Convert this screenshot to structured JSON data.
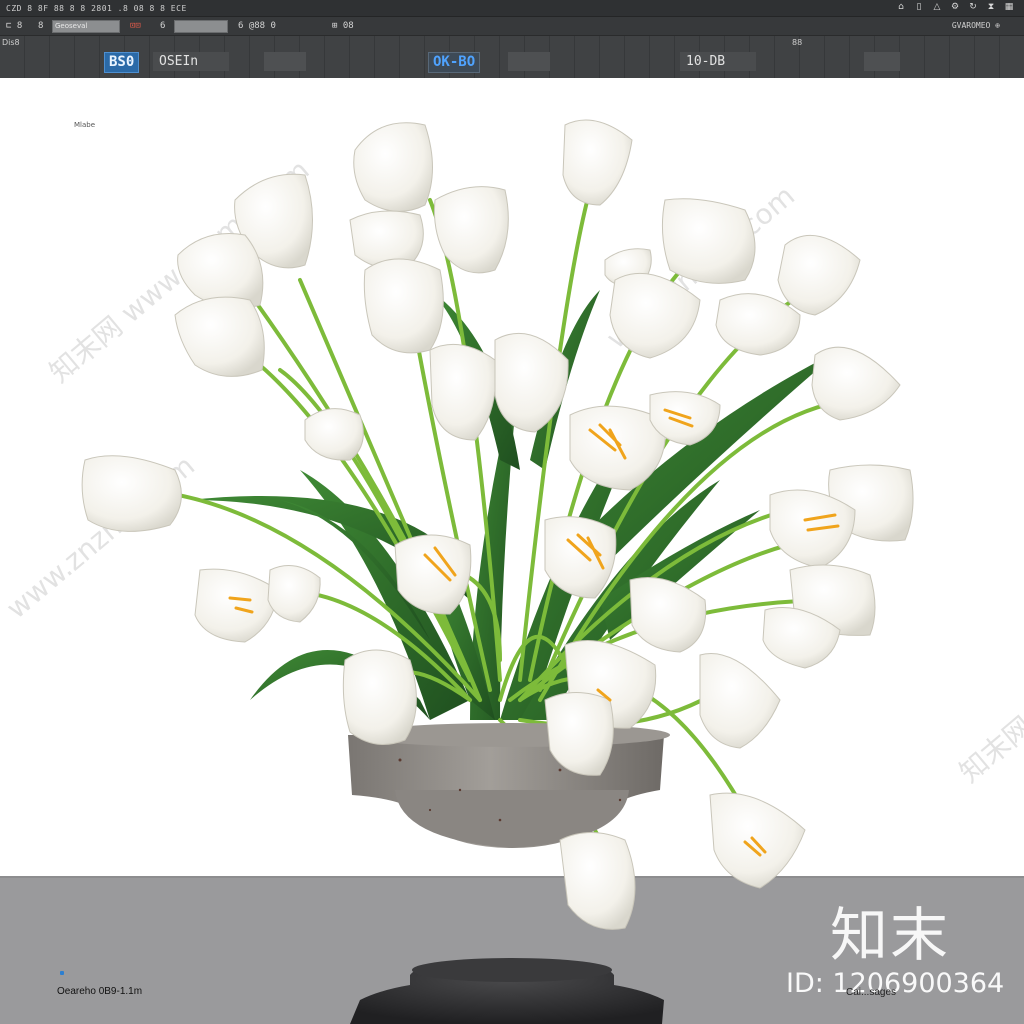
{
  "toolbar": {
    "menu_text": "CZD  8 8F 88 8 8 2801 .8 08 8 8  ECE",
    "right_icons": [
      "home-icon",
      "file-icon",
      "warning-icon",
      "settings-icon",
      "refresh-icon",
      "hourglass-icon",
      "grid-icon"
    ],
    "row2": {
      "icons_left": "⊏  8",
      "field_left": "Geoseval",
      "seg_a": "8",
      "seg_b": "6",
      "field_mid": "",
      "seg_c": "6 @88 0",
      "seg_d": "⊞ 08",
      "config_label": "GVAROMEO ⊕"
    },
    "view": {
      "left_label": "Dis8",
      "mid_label": "88",
      "badge_1": "BS0",
      "label_1": "OSEIn",
      "badge_2": "OK-BO",
      "label_2": "10-DB"
    }
  },
  "canvas": {
    "corner_label": "Mlabe",
    "caption": "Oeareho 0B9-1.1m",
    "right_small": "Cai...sages",
    "watermark_site": "www.znzmo.com",
    "watermark_cn": "知末网",
    "logo": "知末",
    "id_label": "ID: 1206900364"
  },
  "colors": {
    "toolbar_bg": "#3b3d3f",
    "accent_blue": "#2b6aa8",
    "floor": "#9a9a9c",
    "petal": "#f7f5ee",
    "leaf": "#2f6b2a",
    "stem": "#7fbf3a",
    "stamen": "#f0a41c",
    "pot": "#8f8b87"
  }
}
